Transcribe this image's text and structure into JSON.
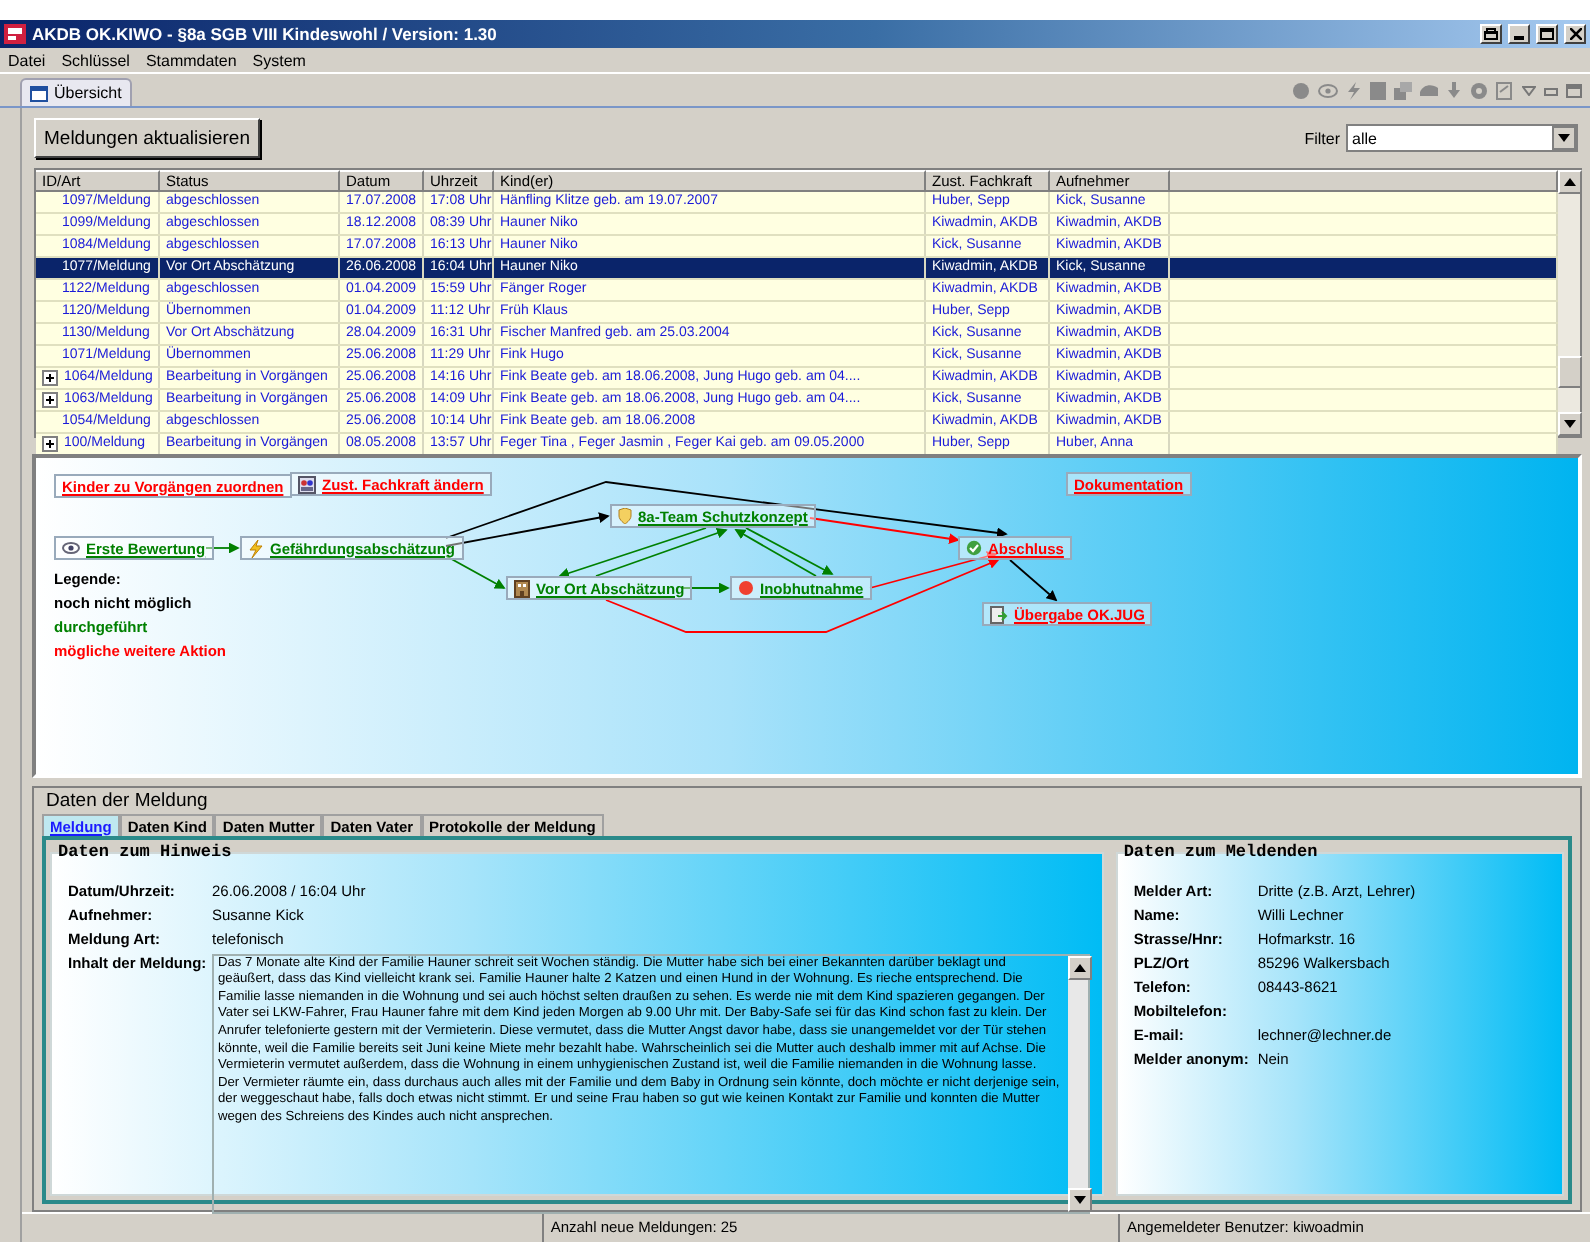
{
  "window": {
    "title": "AKDB OK.KIWO - §8a SGB VIII Kindeswohl / Version: 1.30"
  },
  "menu": [
    "Datei",
    "Schlüssel",
    "Stammdaten",
    "System"
  ],
  "tabs": [
    {
      "label": "Übersicht",
      "selected": true
    }
  ],
  "refresh_button": "Meldungen aktualisieren",
  "filter": {
    "label": "Filter",
    "value": "alle"
  },
  "table": {
    "columns": [
      "ID/Art",
      "Status",
      "Datum",
      "Uhrzeit",
      "Kind(er)",
      "Zust. Fachkraft",
      "Aufnehmer"
    ],
    "rows": [
      {
        "cells": [
          "1097/Meldung",
          "abgeschlossen",
          "17.07.2008",
          "17:08 Uhr",
          "Hänfling Klitze geb. am 19.07.2007",
          "Huber, Sepp",
          "Kick, Susanne"
        ],
        "expandable": false,
        "selected": false
      },
      {
        "cells": [
          "1099/Meldung",
          "abgeschlossen",
          "18.12.2008",
          "08:39 Uhr",
          "Hauner Niko",
          "Kiwadmin, AKDB",
          "Kiwadmin, AKDB"
        ],
        "expandable": false,
        "selected": false
      },
      {
        "cells": [
          "1084/Meldung",
          "abgeschlossen",
          "17.07.2008",
          "16:13 Uhr",
          "Hauner Niko",
          "Kick, Susanne",
          "Kiwadmin, AKDB"
        ],
        "expandable": false,
        "selected": false
      },
      {
        "cells": [
          "1077/Meldung",
          "Vor Ort Abschätzung",
          "26.06.2008",
          "16:04 Uhr",
          "Hauner Niko",
          "Kiwadmin, AKDB",
          "Kick, Susanne"
        ],
        "expandable": false,
        "selected": true
      },
      {
        "cells": [
          "1122/Meldung",
          "abgeschlossen",
          "01.04.2009",
          "15:59 Uhr",
          "Fänger Roger",
          "Kiwadmin, AKDB",
          "Kiwadmin, AKDB"
        ],
        "expandable": false,
        "selected": false
      },
      {
        "cells": [
          "1120/Meldung",
          "Übernommen",
          "01.04.2009",
          "11:12 Uhr",
          "Früh Klaus",
          "Huber, Sepp",
          "Kiwadmin, AKDB"
        ],
        "expandable": false,
        "selected": false
      },
      {
        "cells": [
          "1130/Meldung",
          "Vor Ort Abschätzung",
          "28.04.2009",
          "16:31 Uhr",
          "Fischer Manfred geb. am 25.03.2004",
          "Kick, Susanne",
          "Kiwadmin, AKDB"
        ],
        "expandable": false,
        "selected": false
      },
      {
        "cells": [
          "1071/Meldung",
          "Übernommen",
          "25.06.2008",
          "11:29 Uhr",
          "Fink Hugo",
          "Kick, Susanne",
          "Kiwadmin, AKDB"
        ],
        "expandable": false,
        "selected": false
      },
      {
        "cells": [
          "1064/Meldung",
          "Bearbeitung in Vorgängen",
          "25.06.2008",
          "14:16 Uhr",
          "Fink Beate geb. am 18.06.2008, Jung Hugo geb. am 04....",
          "Kiwadmin, AKDB",
          "Kiwadmin, AKDB"
        ],
        "expandable": true,
        "selected": false
      },
      {
        "cells": [
          "1063/Meldung",
          "Bearbeitung in Vorgängen",
          "25.06.2008",
          "14:09 Uhr",
          "Fink Beate geb. am 18.06.2008, Jung Hugo geb. am 04....",
          "Kick, Susanne",
          "Kiwadmin, AKDB"
        ],
        "expandable": true,
        "selected": false
      },
      {
        "cells": [
          "1054/Meldung",
          "abgeschlossen",
          "25.06.2008",
          "10:14 Uhr",
          "Fink Beate geb. am 18.06.2008",
          "Kiwadmin, AKDB",
          "Kiwadmin, AKDB"
        ],
        "expandable": false,
        "selected": false
      },
      {
        "cells": [
          "100/Meldung",
          "Bearbeitung in Vorgängen",
          "08.05.2008",
          "13:57 Uhr",
          "Feger Tina , Feger Jasmin , Feger Kai geb. am 09.05.2000",
          "Huber, Sepp",
          "Huber, Anna"
        ],
        "expandable": true,
        "selected": false
      }
    ]
  },
  "workflow": {
    "nodes": [
      {
        "label": "Kinder zu Vorgängen zuordnen",
        "kind": "possible"
      },
      {
        "label": "Zust. Fachkraft ändern",
        "kind": "possible"
      },
      {
        "label": "Dokumentation",
        "kind": "possible"
      },
      {
        "label": "Erste Bewertung",
        "kind": "done"
      },
      {
        "label": "Gefährdungsabschätzung",
        "kind": "done"
      },
      {
        "label": "8a-Team Schutzkonzept",
        "kind": "done"
      },
      {
        "label": "Vor Ort Abschätzung",
        "kind": "done"
      },
      {
        "label": "Inobhutnahme",
        "kind": "done"
      },
      {
        "label": "Abschluss",
        "kind": "possible"
      },
      {
        "label": "Übergabe OK.JUG",
        "kind": "possible"
      }
    ],
    "edges": [
      {
        "kind": "done"
      },
      {
        "kind": "not_possible"
      },
      {
        "kind": "not_possible"
      },
      {
        "kind": "done"
      },
      {
        "kind": "done"
      },
      {
        "kind": "done"
      },
      {
        "kind": "done"
      },
      {
        "kind": "done"
      },
      {
        "kind": "done"
      },
      {
        "kind": "possible"
      },
      {
        "kind": "possible"
      },
      {
        "kind": "possible"
      },
      {
        "kind": "not_possible"
      }
    ],
    "legend": {
      "title": "Legende:",
      "items": [
        {
          "label": "noch nicht möglich",
          "kind": "not_possible"
        },
        {
          "label": "durchgeführt",
          "kind": "done"
        },
        {
          "label": "mögliche weitere Aktion",
          "kind": "possible"
        }
      ]
    }
  },
  "details": {
    "title": "Daten der Meldung",
    "tabs": [
      {
        "label": "Meldung",
        "selected": true
      },
      {
        "label": "Daten Kind",
        "selected": false
      },
      {
        "label": "Daten Mutter",
        "selected": false
      },
      {
        "label": "Daten Vater",
        "selected": false
      },
      {
        "label": "Protokolle der Meldung",
        "selected": false
      }
    ],
    "hint": {
      "title": "Daten zum Hinweis",
      "fields": [
        {
          "label": "Datum/Uhrzeit:",
          "value": "26.06.2008 / 16:04 Uhr"
        },
        {
          "label": "Aufnehmer:",
          "value": "Susanne Kick"
        },
        {
          "label": "Meldung Art:",
          "value": "telefonisch"
        }
      ],
      "content_label": "Inhalt der Meldung:",
      "content": [
        "Das 7 Monate alte Kind der Familie Hauner schreit seit Wochen ständig. Die Mutter habe sich bei einer Bekannten darüber beklagt und geäußert, dass das Kind vielleicht krank  sei. Familie Hauner halte 2 Katzen und einen Hund in der Wohnung. Es rieche entsprechend. Die Familie lasse niemanden in die Wohnung und sei auch höchst selten draußen zu sehen. Es werde nie mit dem Kind spazieren gegangen. Der Vater sei LKW-Fahrer, Frau Hauner fahre mit dem Kind jeden Morgen ab 9.00 Uhr mit. Der Baby-Safe sei für das Kind schon fast zu klein. Der Anrufer telefonierte gestern mit der Vermieterin. Diese vermutet, dass die Mutter Angst davor habe, dass sie unangemeldet vor der Tür stehen könnte, weil die Familie bereits seit Juni keine Miete mehr bezahlt habe. Wahrscheinlich sei die Mutter auch deshalb immer mit auf Achse. Die Vermieterin vermutet außerdem, dass die Wohnung in einem unhygienischen Zustand ist, weil die Familie niemanden in die Wohnung lasse.",
        "Der Vermieter räumte ein, dass durchaus auch alles mit der Familie und dem Baby in Ordnung sein könnte, doch möchte er nicht derjenige sein, der weggeschaut habe, falls doch etwas nicht stimmt. Er und seine Frau haben so gut wie keinen Kontakt zur Familie und konnten die Mutter wegen des Schreiens des Kindes auch nicht ansprechen."
      ]
    },
    "reporter": {
      "title": "Daten zum Meldenden",
      "fields": [
        {
          "label": "Melder Art:",
          "value": "Dritte (z.B. Arzt, Lehrer)"
        },
        {
          "label": "Name:",
          "value": "Willi Lechner"
        },
        {
          "label": "Strasse/Hnr:",
          "value": "Hofmarkstr. 16"
        },
        {
          "label": "PLZ/Ort",
          "value": "85296 Walkersbach"
        },
        {
          "label": "Telefon:",
          "value": "08443-8621"
        },
        {
          "label": "Mobiltelefon:"
        },
        {
          "label": "E-mail:",
          "value": "lechner@lechner.de"
        },
        {
          "label": "Melder anonym:",
          "value": "Nein"
        }
      ]
    }
  },
  "status_bar": [
    "Anzahl neue Meldungen: 25",
    "Angemeldeter Benutzer: kiwoadmin"
  ]
}
